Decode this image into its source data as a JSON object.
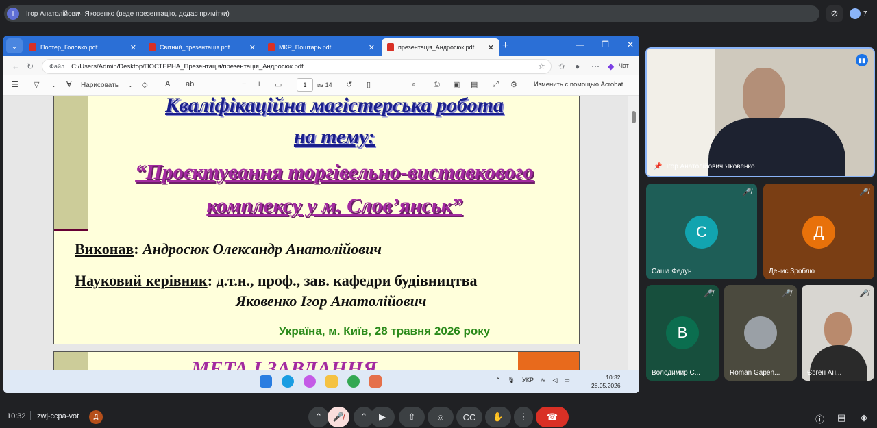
{
  "meet": {
    "presenter_banner": "Ігор Анатолійович Яковенко (веде презентацію, додає примітки)",
    "presenter_initial": "І",
    "participant_count": "7",
    "clock": "10:32",
    "meeting_code": "zwj-ccpa-vot",
    "self_initial": "Д"
  },
  "browser": {
    "tabs": [
      {
        "label": "Постер_Головко.pdf"
      },
      {
        "label": "Світний_презентація.pdf"
      },
      {
        "label": "МКР_Поштарь.pdf"
      },
      {
        "label": "презентація_Андросюк.pdf"
      }
    ],
    "url_label": "Файл",
    "url": "C:/Users/Admin/Desktop/ПОСТЕРНА_Презентація/презентація_Андросюк.pdf",
    "chat_label": "Чат"
  },
  "pdf_toolbar": {
    "draw_label": "Нарисовать",
    "page_current": "1",
    "page_total": "из 14",
    "edit_acrobat": "Изменить с помощью Acrobat"
  },
  "slide1": {
    "title_line1": "Кваліфікаційна магістерська робота",
    "title_line2": "на тему:",
    "title_line3": "“Проєктування торгівельно-виставкового",
    "title_line4": "комплексу у м. Слов’янськ”",
    "author_label": "Виконав",
    "author_name": "Андросюк Олександр Анатолійович",
    "supervisor_label": "Науковий керівник",
    "supervisor_title": "д.т.н., проф., зав. кафедри будівництва",
    "supervisor_name": "Яковенко Ігор Анатолійович",
    "place_date": "Україна, м. Київ, 28 травня 2026 року"
  },
  "slide2": {
    "title": "МЕТА І ЗАВДАННЯ"
  },
  "taskbar": {
    "lang": "УКР",
    "time": "10:32",
    "date": "28.05.2026"
  },
  "participants": {
    "main": {
      "name": "Ігор Анатолійович Яковенко"
    },
    "tiles": [
      {
        "name": "Саша Федун",
        "initial": "С",
        "color": "#12a4af"
      },
      {
        "name": "Денис Зроблю",
        "initial": "Д",
        "color": "#e8710a"
      },
      {
        "name": "Володимир С...",
        "initial": "В",
        "color": "#0b6e4f"
      },
      {
        "name": "Roman Gapen...",
        "initial": "",
        "color": "#9aa0a6"
      },
      {
        "name": "Євген Ан...",
        "initial": "",
        "color": "#5b5b5b"
      }
    ]
  }
}
